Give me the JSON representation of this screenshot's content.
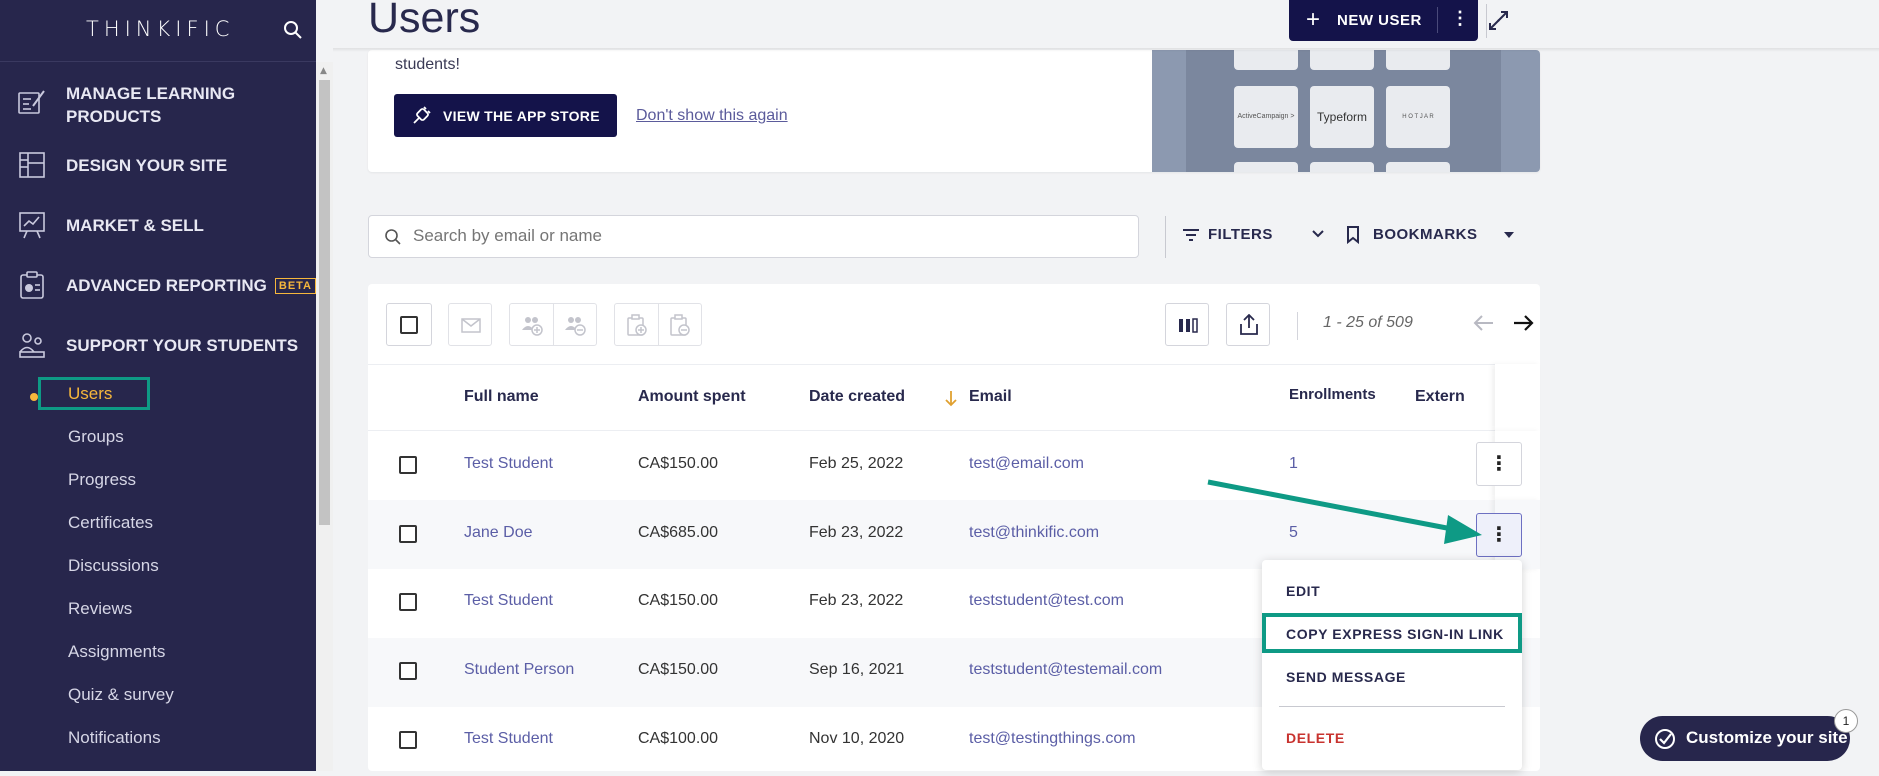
{
  "sidebar": {
    "logo": "THINKIFIC",
    "nav": [
      {
        "label_line1": "MANAGE LEARNING",
        "label_line2": "PRODUCTS",
        "icon": "pencil-list-icon"
      },
      {
        "label": "DESIGN YOUR SITE",
        "icon": "layout-icon"
      },
      {
        "label": "MARKET & SELL",
        "icon": "chart-board-icon"
      },
      {
        "label": "ADVANCED REPORTING",
        "badge": "BETA",
        "icon": "report-clipboard-icon"
      },
      {
        "label": "SUPPORT YOUR STUDENTS",
        "icon": "people-icon"
      }
    ],
    "sub": [
      "Users",
      "Groups",
      "Progress",
      "Certificates",
      "Discussions",
      "Reviews",
      "Assignments",
      "Quiz & survey",
      "Notifications"
    ]
  },
  "header": {
    "title": "Users",
    "new_user": "NEW USER"
  },
  "banner": {
    "text": "students!",
    "app_store": "VIEW THE APP STORE",
    "dont_show": "Don't show this again",
    "tiles": [
      "ActiveCampaign >",
      "Typeform",
      "H O T J A R"
    ]
  },
  "search": {
    "placeholder": "Search by email or name"
  },
  "filters": "FILTERS",
  "bookmarks": "BOOKMARKS",
  "pager": "1 - 25 of 509",
  "table": {
    "headers": [
      "Full name",
      "Amount spent",
      "Date created",
      "Email",
      "Enrollments",
      "Extern"
    ],
    "rows": [
      {
        "name": "Test Student",
        "amount": "CA$150.00",
        "date": "Feb 25, 2022",
        "email": "test@email.com",
        "enrollments": "1"
      },
      {
        "name": "Jane Doe",
        "amount": "CA$685.00",
        "date": "Feb 23, 2022",
        "email": "test@thinkific.com",
        "enrollments": "5"
      },
      {
        "name": "Test Student",
        "amount": "CA$150.00",
        "date": "Feb 23, 2022",
        "email": "teststudent@test.com",
        "enrollments": ""
      },
      {
        "name": "Student Person",
        "amount": "CA$150.00",
        "date": "Sep 16, 2021",
        "email": "teststudent@testemail.com",
        "enrollments": ""
      },
      {
        "name": "Test Student",
        "amount": "CA$100.00",
        "date": "Nov 10, 2020",
        "email": "test@testingthings.com",
        "enrollments": ""
      }
    ]
  },
  "menu": {
    "edit": "EDIT",
    "copy_link": "COPY EXPRESS SIGN-IN LINK",
    "send_message": "SEND MESSAGE",
    "delete": "DELETE"
  },
  "customize": {
    "label": "Customize your site",
    "notif": "1"
  },
  "colors": {
    "sidebar": "#27264c",
    "primary": "#14134a",
    "highlight": "#0e9a85",
    "accent": "#f6b73c",
    "link": "#5b5ea6",
    "danger": "#c8332f"
  }
}
